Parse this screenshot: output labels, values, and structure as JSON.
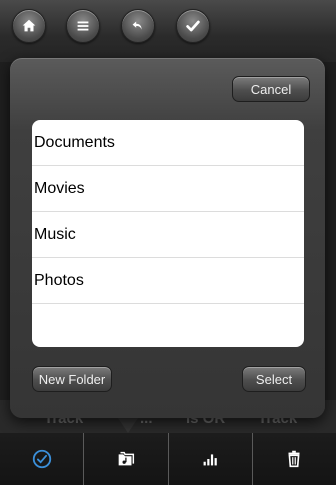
{
  "toolbar": {
    "icons": [
      "home-icon",
      "menu-icon",
      "undo-icon",
      "check-icon"
    ]
  },
  "background_row": {
    "fragments": [
      "Track",
      "...",
      "is OR",
      "Track"
    ]
  },
  "popover": {
    "cancel_label": "Cancel",
    "new_folder_label": "New Folder",
    "select_label": "Select",
    "folders": [
      "Documents",
      "Movies",
      "Music",
      "Photos"
    ]
  },
  "tabbar": {
    "icons": [
      "checkmark-circle-icon",
      "folder-music-icon",
      "equalizer-icon",
      "trash-icon"
    ],
    "active_color": "#3b8fd9"
  }
}
